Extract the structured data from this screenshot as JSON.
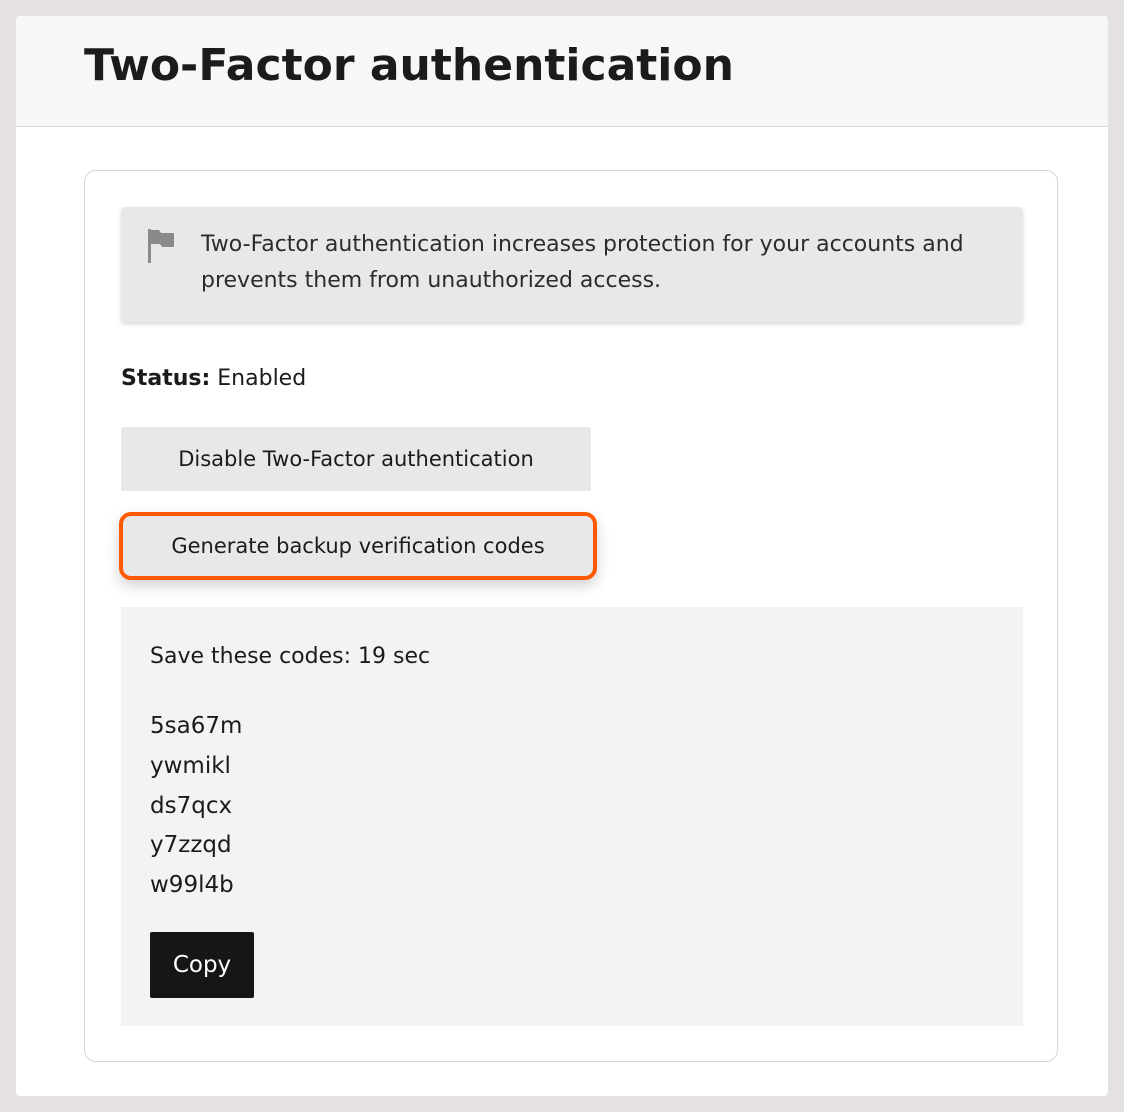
{
  "page": {
    "title": "Two-Factor authentication"
  },
  "info_banner": {
    "icon": "flag-icon",
    "text": "Two-Factor authentication increases protection for your accounts and prevents them from unauthorized access."
  },
  "status": {
    "label": "Status:",
    "value": "Enabled"
  },
  "actions": {
    "disable_label": "Disable Two-Factor authentication",
    "generate_label": "Generate backup verification codes"
  },
  "backup_codes": {
    "countdown_label": "Save these codes: 19 sec",
    "codes": [
      "5sa67m",
      "ywmikl",
      "ds7qcx",
      "y7zzqd",
      "w99l4b"
    ],
    "copy_label": "Copy"
  },
  "colors": {
    "highlight": "#ff5a00",
    "banner_bg": "#e8e8e8",
    "panel_bg": "#f3f3f3",
    "primary_button_bg": "#161616"
  }
}
